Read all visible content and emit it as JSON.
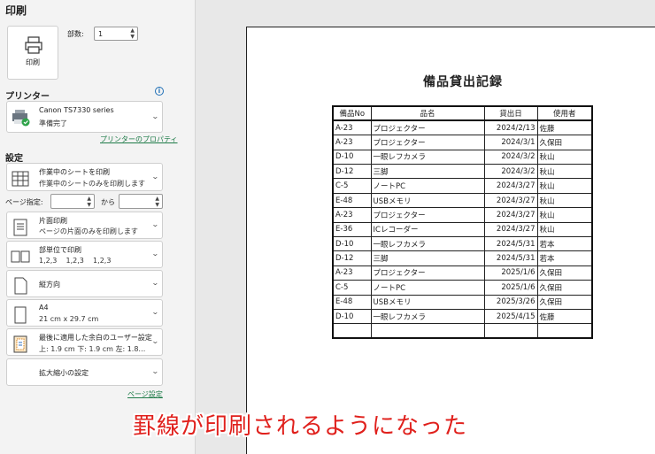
{
  "header": {
    "title": "印刷"
  },
  "print_button": {
    "label": "印刷"
  },
  "copies": {
    "label": "部数:",
    "value": "1"
  },
  "printer": {
    "section_title": "プリンター",
    "name": "Canon TS7330 series",
    "status": "準備完了",
    "properties_link": "プリンターのプロパティ"
  },
  "settings": {
    "section_title": "設定",
    "sheet_scope": {
      "title": "作業中のシートを印刷",
      "sub": "作業中のシートのみを印刷します"
    },
    "page_range": {
      "label": "ページ指定:",
      "from": "",
      "to_label": "から",
      "to": ""
    },
    "sides": {
      "title": "片面印刷",
      "sub": "ページの片面のみを印刷します"
    },
    "collate": {
      "title": "部単位で印刷",
      "sub": "1,2,3    1,2,3    1,2,3"
    },
    "orientation": {
      "title": "縦方向"
    },
    "paper": {
      "title": "A4",
      "sub": "21 cm x 29.7 cm"
    },
    "margins": {
      "title": "最後に適用した余白のユーザー設定",
      "sub": "上: 1.9 cm 下: 1.9 cm 左: 1.8…"
    },
    "scaling": {
      "title": "拡大縮小の設定"
    },
    "page_setup_link": "ページ設定"
  },
  "preview": {
    "doc_title": "備品貸出記録",
    "headers": [
      "備品No",
      "品名",
      "貸出日",
      "使用者"
    ],
    "rows": [
      [
        "A-23",
        "プロジェクター",
        "2024/2/13",
        "佐藤"
      ],
      [
        "A-23",
        "プロジェクター",
        "2024/3/1",
        "久保田"
      ],
      [
        "D-10",
        "一眼レフカメラ",
        "2024/3/2",
        "秋山"
      ],
      [
        "D-12",
        "三脚",
        "2024/3/2",
        "秋山"
      ],
      [
        "C-5",
        "ノートPC",
        "2024/3/27",
        "秋山"
      ],
      [
        "E-48",
        "USBメモリ",
        "2024/3/27",
        "秋山"
      ],
      [
        "A-23",
        "プロジェクター",
        "2024/3/27",
        "秋山"
      ],
      [
        "E-36",
        "ICレコーダー",
        "2024/3/27",
        "秋山"
      ],
      [
        "D-10",
        "一眼レフカメラ",
        "2024/5/31",
        "若本"
      ],
      [
        "D-12",
        "三脚",
        "2024/5/31",
        "若本"
      ],
      [
        "A-23",
        "プロジェクター",
        "2025/1/6",
        "久保田"
      ],
      [
        "C-5",
        "ノートPC",
        "2025/1/6",
        "久保田"
      ],
      [
        "E-48",
        "USBメモリ",
        "2025/3/26",
        "久保田"
      ],
      [
        "D-10",
        "一眼レフカメラ",
        "2025/4/15",
        "佐藤"
      ],
      [
        "",
        "",
        "",
        ""
      ]
    ]
  },
  "caption": "罫線が印刷されるようになった",
  "colors": {
    "link": "#1e7b48",
    "caption": "#e0201c",
    "info": "#1f6fb6"
  }
}
